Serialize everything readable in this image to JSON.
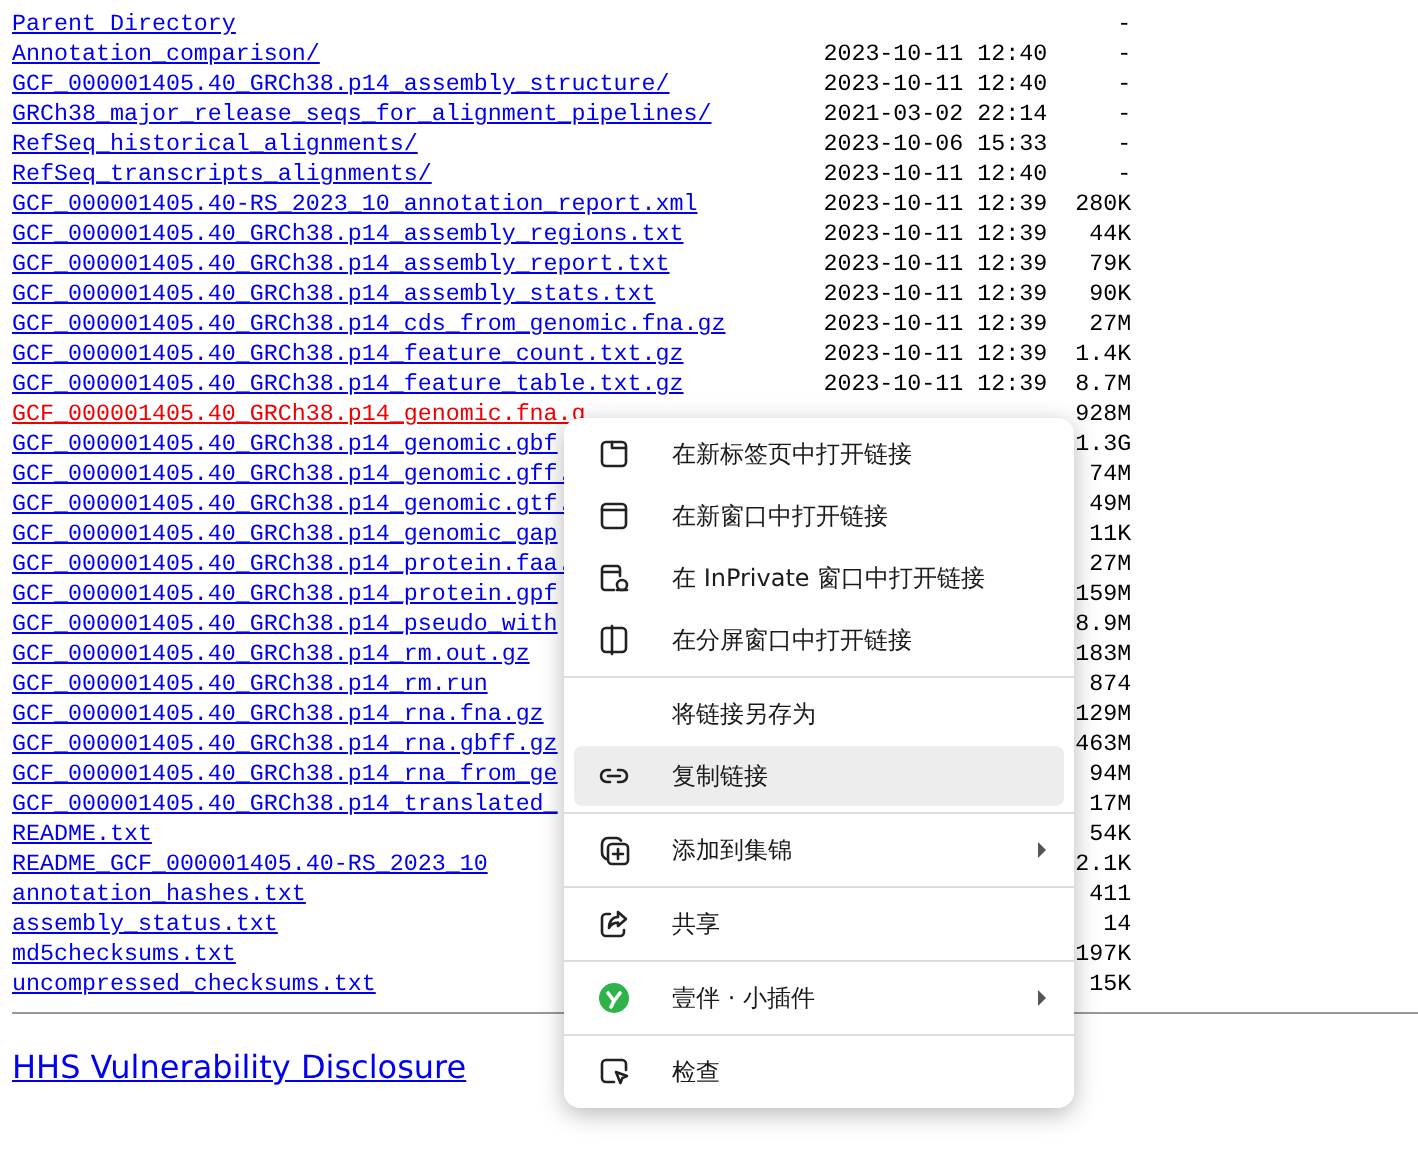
{
  "listing": [
    {
      "name": "Parent Directory",
      "size": "-",
      "active": false
    },
    {
      "name": "Annotation_comparison/",
      "date": "2023-10-11 12:40",
      "size": "-",
      "active": false
    },
    {
      "name": "GCF_000001405.40_GRCh38.p14_assembly_structure/",
      "date": "2023-10-11 12:40",
      "size": "-",
      "active": false
    },
    {
      "name": "GRCh38_major_release_seqs_for_alignment_pipelines/",
      "date": "2021-03-02 22:14",
      "size": "-",
      "active": false
    },
    {
      "name": "RefSeq_historical_alignments/",
      "date": "2023-10-06 15:33",
      "size": "-",
      "active": false
    },
    {
      "name": "RefSeq_transcripts_alignments/",
      "date": "2023-10-11 12:40",
      "size": "-",
      "active": false
    },
    {
      "name": "GCF_000001405.40-RS_2023_10_annotation_report.xml",
      "date": "2023-10-11 12:39",
      "size": "280K",
      "active": false
    },
    {
      "name": "GCF_000001405.40_GRCh38.p14_assembly_regions.txt",
      "date": "2023-10-11 12:39",
      "size": "44K",
      "active": false
    },
    {
      "name": "GCF_000001405.40_GRCh38.p14_assembly_report.txt",
      "date": "2023-10-11 12:39",
      "size": "79K",
      "active": false
    },
    {
      "name": "GCF_000001405.40_GRCh38.p14_assembly_stats.txt",
      "date": "2023-10-11 12:39",
      "size": "90K",
      "active": false
    },
    {
      "name": "GCF_000001405.40_GRCh38.p14_cds_from_genomic.fna.gz",
      "date": "2023-10-11 12:39",
      "size": "27M",
      "active": false
    },
    {
      "name": "GCF_000001405.40_GRCh38.p14_feature_count.txt.gz",
      "date": "2023-10-11 12:39",
      "size": "1.4K",
      "active": false
    },
    {
      "name": "GCF_000001405.40_GRCh38.p14_feature_table.txt.gz",
      "date": "2023-10-11 12:39",
      "size": "8.7M",
      "active": false
    },
    {
      "name": "GCF_000001405.40_GRCh38.p14_genomic.fna.g",
      "size": "928M",
      "active": true
    },
    {
      "name": "GCF_000001405.40_GRCh38.p14_genomic.gbf",
      "size": "1.3G",
      "active": false
    },
    {
      "name": "GCF_000001405.40_GRCh38.p14_genomic.gff.",
      "size": "74M",
      "active": false
    },
    {
      "name": "GCF_000001405.40_GRCh38.p14_genomic.gtf.",
      "size": "49M",
      "active": false
    },
    {
      "name": "GCF_000001405.40_GRCh38.p14_genomic_gap",
      "size": "11K",
      "active": false
    },
    {
      "name": "GCF_000001405.40_GRCh38.p14_protein.faa.",
      "size": "27M",
      "active": false
    },
    {
      "name": "GCF_000001405.40_GRCh38.p14_protein.gpf",
      "size": "159M",
      "active": false
    },
    {
      "name": "GCF_000001405.40_GRCh38.p14_pseudo_with",
      "size": "8.9M",
      "active": false
    },
    {
      "name": "GCF_000001405.40_GRCh38.p14_rm.out.gz",
      "size": "183M",
      "active": false
    },
    {
      "name": "GCF_000001405.40_GRCh38.p14_rm.run",
      "size": "874",
      "active": false
    },
    {
      "name": "GCF_000001405.40_GRCh38.p14_rna.fna.gz",
      "size": "129M",
      "active": false
    },
    {
      "name": "GCF_000001405.40_GRCh38.p14_rna.gbff.gz",
      "size": "463M",
      "active": false
    },
    {
      "name": "GCF_000001405.40_GRCh38.p14_rna_from_ge",
      "size": "94M",
      "active": false
    },
    {
      "name": "GCF_000001405.40_GRCh38.p14_translated_",
      "size": "17M",
      "active": false
    },
    {
      "name": "README.txt",
      "size": "54K",
      "active": false
    },
    {
      "name": "README_GCF_000001405.40-RS_2023_10",
      "size": "2.1K",
      "active": false
    },
    {
      "name": "annotation_hashes.txt",
      "size": "411",
      "active": false
    },
    {
      "name": "assembly_status.txt",
      "size": "14",
      "active": false
    },
    {
      "name": "md5checksums.txt",
      "size": "197K",
      "active": false
    },
    {
      "name": "uncompressed_checksums.txt",
      "size": "15K",
      "active": false
    }
  ],
  "footer_link": "HHS Vulnerability Disclosure",
  "context_menu": {
    "groups": [
      [
        {
          "label": "在新标签页中打开链接",
          "kind": "tab",
          "selected": false,
          "submenu": false
        },
        {
          "label": "在新窗口中打开链接",
          "kind": "window",
          "selected": false,
          "submenu": false
        },
        {
          "label": "在 InPrivate 窗口中打开链接",
          "kind": "private",
          "selected": false,
          "submenu": false
        },
        {
          "label": "在分屏窗口中打开链接",
          "kind": "split",
          "selected": false,
          "submenu": false
        }
      ],
      [
        {
          "label": "将链接另存为",
          "kind": "plain",
          "selected": false,
          "submenu": false
        },
        {
          "label": "复制链接",
          "kind": "link",
          "selected": true,
          "submenu": false
        }
      ],
      [
        {
          "label": "添加到集锦",
          "kind": "collection",
          "selected": false,
          "submenu": true
        }
      ],
      [
        {
          "label": "共享",
          "kind": "share",
          "selected": false,
          "submenu": false
        }
      ],
      [
        {
          "label": "壹伴 · 小插件",
          "kind": "badge",
          "selected": false,
          "submenu": true
        }
      ],
      [
        {
          "label": "检查",
          "kind": "inspect",
          "selected": false,
          "submenu": false
        }
      ]
    ]
  }
}
